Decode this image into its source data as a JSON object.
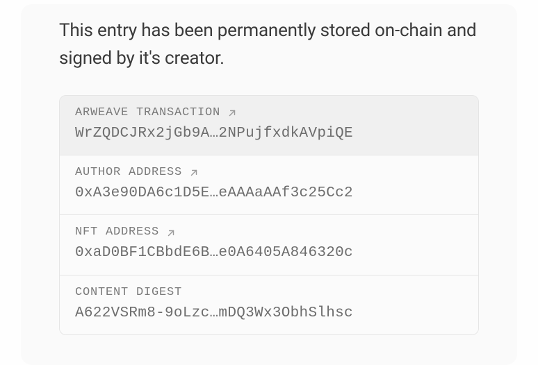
{
  "description": "This entry has been permanently stored on-chain and signed by it's creator.",
  "records": [
    {
      "label": "ARWEAVE TRANSACTION",
      "value": "WrZQDCJRx2jGb9A…2NPujfxdkAVpiQE",
      "has_link": true
    },
    {
      "label": "AUTHOR ADDRESS",
      "value": "0xA3e90DA6c1D5E…eAAAaAAf3c25Cc2",
      "has_link": true
    },
    {
      "label": "NFT ADDRESS",
      "value": "0xaD0BF1CBbdE6B…e0A6405A846320c",
      "has_link": true
    },
    {
      "label": "CONTENT DIGEST",
      "value": "A622VSRm8-9oLzc…mDQ3Wx3ObhSlhsc",
      "has_link": false
    }
  ]
}
